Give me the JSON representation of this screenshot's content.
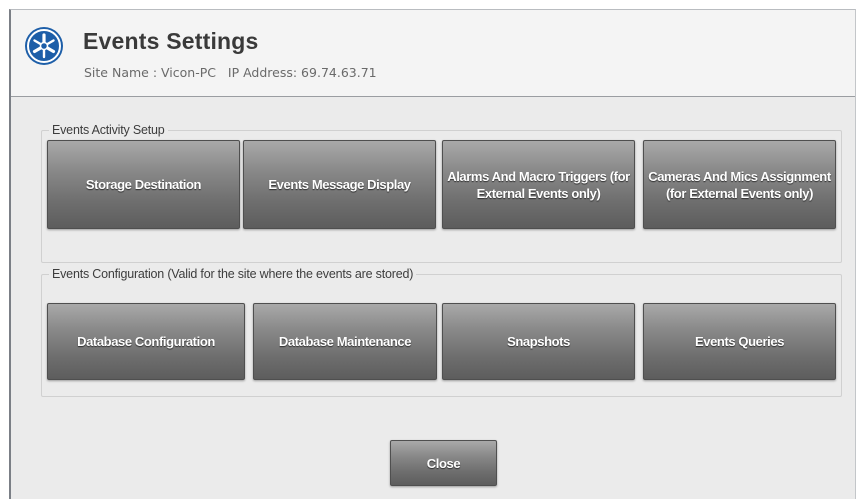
{
  "header": {
    "title": "Events Settings",
    "subtitle": "Site Name : Vicon-PC   IP Address: 69.74.63.71",
    "logo_icon": "vicon-logo-icon",
    "accent_color": "#1d5ea8"
  },
  "activity_setup": {
    "legend": "Events Activity Setup",
    "buttons": [
      "Storage Destination",
      "Events Message Display",
      "Alarms And Macro Triggers (for External Events only)",
      "Cameras And Mics Assignment (for External Events only)"
    ]
  },
  "configuration": {
    "legend": "Events Configuration (Valid for the site where the events are stored)",
    "buttons": [
      "Database Configuration",
      "Database Maintenance",
      "Snapshots",
      "Events Queries"
    ]
  },
  "footer": {
    "close_label": "Close"
  }
}
